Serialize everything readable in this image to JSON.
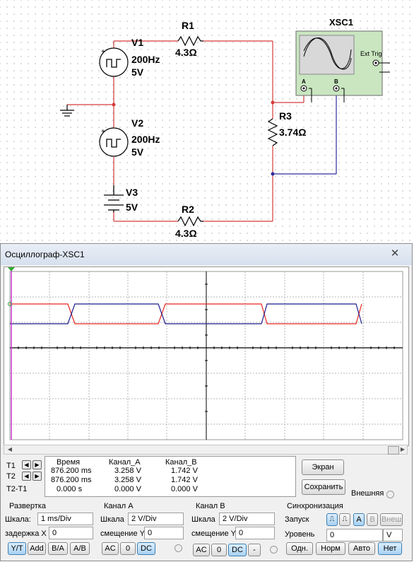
{
  "circuit": {
    "v1": {
      "name": "V1",
      "freq": "200Hz",
      "volt": "5V"
    },
    "v2": {
      "name": "V2",
      "freq": "200Hz",
      "volt": "5V"
    },
    "v3": {
      "name": "V3",
      "volt": "5V"
    },
    "r1": {
      "name": "R1",
      "value": "4.3Ω"
    },
    "r2": {
      "name": "R2",
      "value": "4.3Ω"
    },
    "r3": {
      "name": "R3",
      "value": "3.74Ω"
    },
    "xsc1": {
      "name": "XSC1",
      "ext_trig": "Ext Trig",
      "chan_a": "A",
      "chan_b": "B"
    }
  },
  "window": {
    "title": "Осциллограф-XSC1"
  },
  "readout": {
    "headers": [
      "Время",
      "Канал_A",
      "Канал_B"
    ],
    "rows": [
      {
        "label": "T1",
        "time": "876.200 ms",
        "a": "3.258 V",
        "b": "1.742 V"
      },
      {
        "label": "T2",
        "time": "876.200 ms",
        "a": "3.258 V",
        "b": "1.742 V"
      },
      {
        "label": "T2-T1",
        "time": "0.000 s",
        "a": "0.000 V",
        "b": "0.000 V"
      }
    ]
  },
  "buttons": {
    "screen": "Экран",
    "save": "Сохранить",
    "external": "Внешняя"
  },
  "timebase": {
    "title": "Развертка",
    "scale_label": "Шкала:",
    "scale": "1 ms/Div",
    "delay_label": "задержка X",
    "delay": "0",
    "modes": [
      "Y/T",
      "Add",
      "B/A",
      "A/B"
    ]
  },
  "channel_a": {
    "title": "Канал A",
    "scale_label": "Шкала",
    "scale": "2  V/Div",
    "offset_label": "смещение Y",
    "offset": "0",
    "coupling": [
      "AC",
      "0",
      "DC"
    ]
  },
  "channel_b": {
    "title": "Канал B",
    "scale_label": "Шкала",
    "scale": "2  V/Div",
    "offset_label": "смещение Y",
    "offset": "0",
    "coupling": [
      "AC",
      "0",
      "DC",
      "-"
    ]
  },
  "sync": {
    "title": "Синхронизация",
    "trigger_label": "Запуск",
    "level_label": "Уровень",
    "level": "0",
    "unit": "V",
    "sources": [
      "A",
      "B",
      "Внеш"
    ],
    "modes": [
      "Одн.",
      "Норм",
      "Авто",
      "Нет"
    ]
  },
  "colors": {
    "channel_a": "#e8261e",
    "channel_b": "#1c1c8c",
    "cursor": "#cc33cc",
    "wire_red": "#d63a3a",
    "wire_blue": "#2d2d9e"
  }
}
